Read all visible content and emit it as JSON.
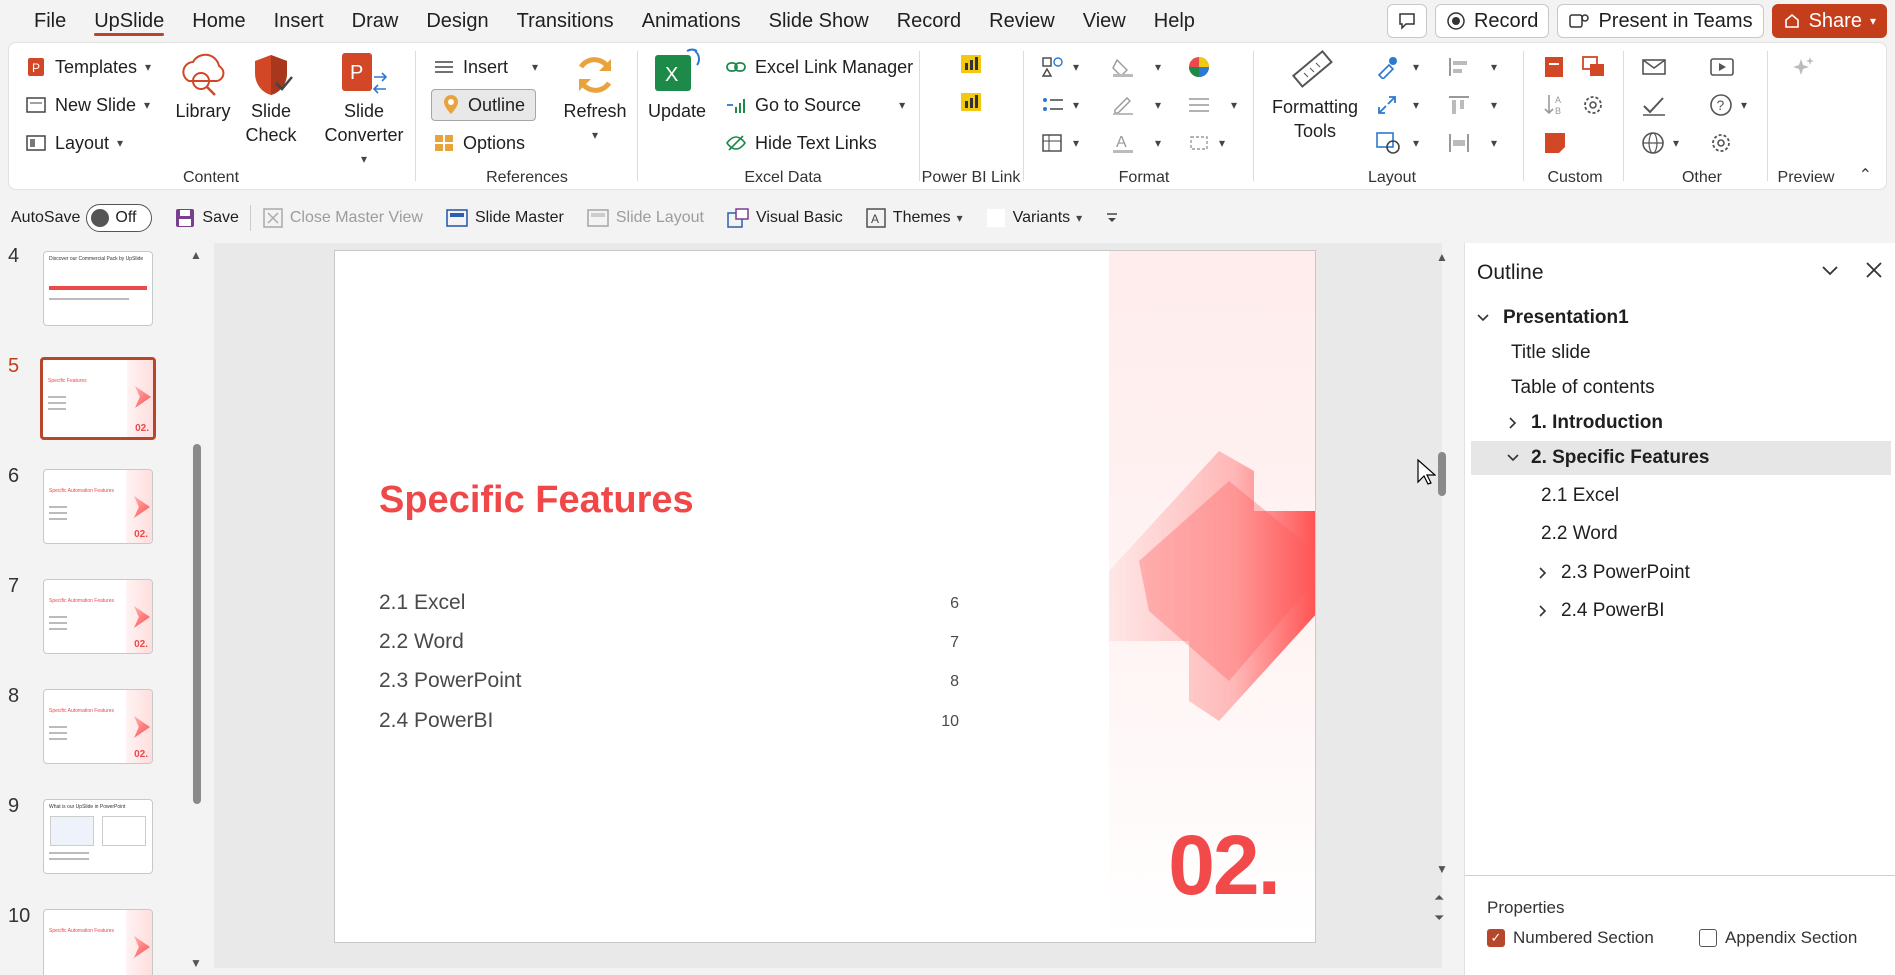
{
  "menu": {
    "tabs": [
      "File",
      "UpSlide",
      "Home",
      "Insert",
      "Draw",
      "Design",
      "Transitions",
      "Animations",
      "Slide Show",
      "Record",
      "Review",
      "View",
      "Help"
    ],
    "active_tab": "UpSlide",
    "record_label": "Record",
    "present_label": "Present in Teams",
    "share_label": "Share"
  },
  "ribbon": {
    "content": {
      "label": "Content",
      "templates": "Templates",
      "new_slide": "New Slide",
      "layout": "Layout",
      "library": "Library",
      "slide_check": "Slide Check",
      "slide_converter": "Slide Converter"
    },
    "references": {
      "label": "References",
      "insert": "Insert",
      "outline": "Outline",
      "options": "Options",
      "refresh": "Refresh"
    },
    "excel": {
      "label": "Excel Data",
      "update": "Update",
      "link_manager": "Excel Link Manager",
      "go_to_source": "Go to Source",
      "hide_links": "Hide Text Links"
    },
    "powerbi": {
      "label": "Power BI Link"
    },
    "format": {
      "label": "Format"
    },
    "layout": {
      "label": "Layout",
      "formatting_tools": "Formatting Tools"
    },
    "custom": {
      "label": "Custom"
    },
    "other": {
      "label": "Other"
    },
    "preview": {
      "label": "Preview"
    }
  },
  "qat": {
    "autosave": "AutoSave",
    "autosave_state": "Off",
    "save": "Save",
    "close_master": "Close Master View",
    "slide_master": "Slide Master",
    "slide_layout": "Slide Layout",
    "visual_basic": "Visual Basic",
    "themes": "Themes",
    "variants": "Variants"
  },
  "thumbnails": [
    {
      "num": "4",
      "title": "Discover our Commercial Pack by UpSlide"
    },
    {
      "num": "5",
      "title": "Specific Features",
      "selected": true
    },
    {
      "num": "6",
      "title": "Specific Automation Features"
    },
    {
      "num": "7",
      "title": "Specific Automation Features"
    },
    {
      "num": "8",
      "title": "Specific Automation Features"
    },
    {
      "num": "9",
      "title": "What is our UpSlide in PowerPoint"
    },
    {
      "num": "10",
      "title": "Specific Automation Features"
    }
  ],
  "slide": {
    "title": "Specific Features",
    "items": [
      {
        "label": "2.1 Excel",
        "page": "6"
      },
      {
        "label": "2.2 Word",
        "page": "7"
      },
      {
        "label": "2.3 PowerPoint",
        "page": "8"
      },
      {
        "label": "2.4 PowerBI",
        "page": "10"
      }
    ],
    "section_number": "02."
  },
  "outline_pane": {
    "title": "Outline",
    "tree": {
      "root": "Presentation1",
      "title_slide": "Title slide",
      "toc": "Table of contents",
      "intro": "1. Introduction",
      "specific": "2. Specific Features",
      "excel": "2.1 Excel",
      "word": "2.2 Word",
      "powerpoint": "2.3 PowerPoint",
      "powerbi": "2.4 PowerBI"
    },
    "properties_title": "Properties",
    "numbered_section": "Numbered Section",
    "numbered_checked": true,
    "appendix_section": "Appendix Section",
    "appendix_checked": false
  },
  "colors": {
    "accent": "#b7472a",
    "slide_red": "#f04848"
  }
}
